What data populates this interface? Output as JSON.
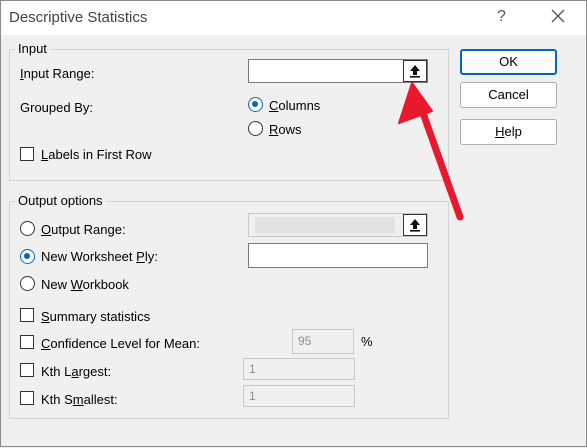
{
  "window": {
    "title": "Descriptive Statistics",
    "help_glyph": "?",
    "close_glyph": "✕"
  },
  "input": {
    "legend": "Input",
    "range_label_pre": "",
    "range_label_u": "I",
    "range_label_post": "nput Range:",
    "range_value": "",
    "grouped_label": "Grouped By:",
    "columns_u": "C",
    "columns_rest": "olumns",
    "rows_u": "R",
    "rows_rest": "ows",
    "labels_u": "L",
    "labels_rest": "abels in First Row"
  },
  "output": {
    "legend": "Output options",
    "output_range_u": "O",
    "output_range_rest": "utput Range:",
    "new_ply_pre": "New Worksheet ",
    "new_ply_u": "P",
    "new_ply_rest": "ly:",
    "new_workbook_pre": "New ",
    "new_workbook_u": "W",
    "new_workbook_rest": "orkbook",
    "summary_u": "S",
    "summary_rest": "ummary statistics",
    "confidence_u": "C",
    "confidence_rest": "onfidence Level for Mean:",
    "confidence_value": "95",
    "percent": "%",
    "kth_largest_pre": "Kth L",
    "kth_largest_u": "a",
    "kth_largest_rest": "rgest:",
    "kth_largest_value": "1",
    "kth_smallest_pre": "Kth S",
    "kth_smallest_u": "m",
    "kth_smallest_rest": "allest:",
    "kth_smallest_value": "1"
  },
  "buttons": {
    "ok": "OK",
    "cancel": "Cancel",
    "help_u": "H",
    "help_rest": "elp"
  },
  "state": {
    "grouped_by": "Columns",
    "output_option": "New Worksheet Ply",
    "labels_first_row": false,
    "summary_statistics": false,
    "confidence_level": false,
    "kth_largest": false,
    "kth_smallest": false
  },
  "colors": {
    "accent": "#0067c0",
    "annotation_arrow": "#e8192c"
  },
  "icons": {
    "ref_button": "collapse-dialog-icon",
    "annotation": "red-arrow-annotation"
  }
}
